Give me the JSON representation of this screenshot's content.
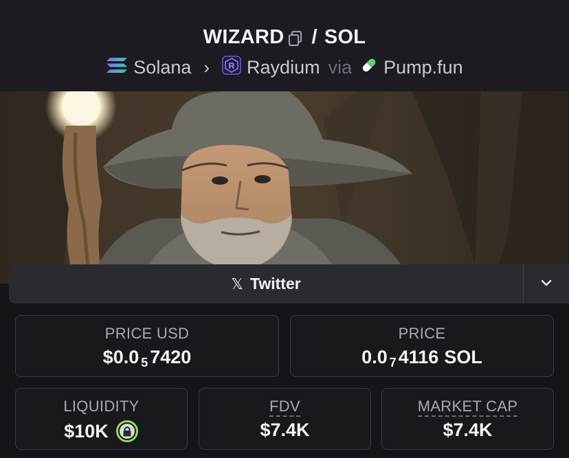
{
  "header": {
    "token": "WIZARD",
    "separator": "/",
    "quote": "SOL",
    "chain": "Solana",
    "dex": "Raydium",
    "via": "via",
    "launchpad": "Pump.fun"
  },
  "colors": {
    "background": "#141419",
    "header": "#1b1b21",
    "card_border": "#3a3a43",
    "lock_green": "#8be04e",
    "raydium": "#6b5bd6"
  },
  "social": {
    "twitter_label": "Twitter",
    "icon": "x-logo-icon"
  },
  "stats": {
    "price_usd": {
      "label": "PRICE USD",
      "prefix": "$0.0",
      "zeros": "5",
      "digits": "7420"
    },
    "price": {
      "label": "PRICE",
      "prefix": "0.0",
      "zeros": "7",
      "digits": "4116",
      "unit": "SOL"
    },
    "liquidity": {
      "label": "LIQUIDITY",
      "value": "$10K"
    },
    "fdv": {
      "label": "FDV",
      "value": "$7.4K"
    },
    "market_cap": {
      "label": "MARKET CAP",
      "value": "$7.4K"
    }
  }
}
